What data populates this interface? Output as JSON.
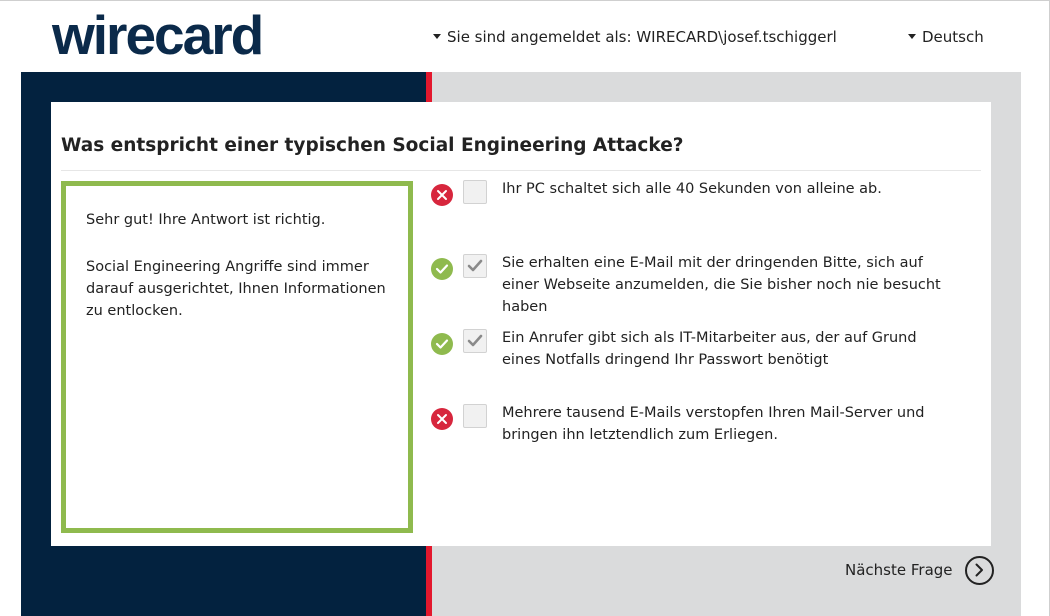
{
  "header": {
    "logo_text": "wirecard",
    "user_menu": "Sie sind angemeldet als: WIRECARD\\josef.tschiggerl",
    "language": "Deutsch"
  },
  "quiz": {
    "question": "Was entspricht einer typischen Social Engineering Attacke?",
    "feedback": {
      "title": "Sehr gut! Ihre Antwort ist richtig.",
      "text": "Social Engineering Angriffe sind immer darauf ausgerichtet, Ihnen Informationen zu entlocken."
    },
    "answers": [
      {
        "text": "Ihr PC schaltet sich alle 40 Sekunden von alleine ab.",
        "status": "wrong-icon",
        "checked": false
      },
      {
        "text": "Sie erhalten eine E-Mail mit der dringenden Bitte, sich auf einer Webseite anzumelden, die Sie bisher noch nie besucht haben",
        "status": "correct-icon",
        "checked": true
      },
      {
        "text": "Ein Anrufer gibt sich als IT-Mitarbeiter aus, der auf Grund eines Notfalls dringend Ihr Passwort benötigt",
        "status": "correct-icon",
        "checked": true
      },
      {
        "text": "Mehrere tausend E-Mails verstopfen Ihren Mail-Server und bringen ihn letztendlich zum Erliegen.",
        "status": "wrong-icon",
        "checked": false
      }
    ],
    "next_label": "Nächste Frage"
  },
  "colors": {
    "brand_navy": "#03223f",
    "accent_red": "#e3182d",
    "correct_green": "#8fba4e",
    "wrong_red": "#d7263d"
  }
}
